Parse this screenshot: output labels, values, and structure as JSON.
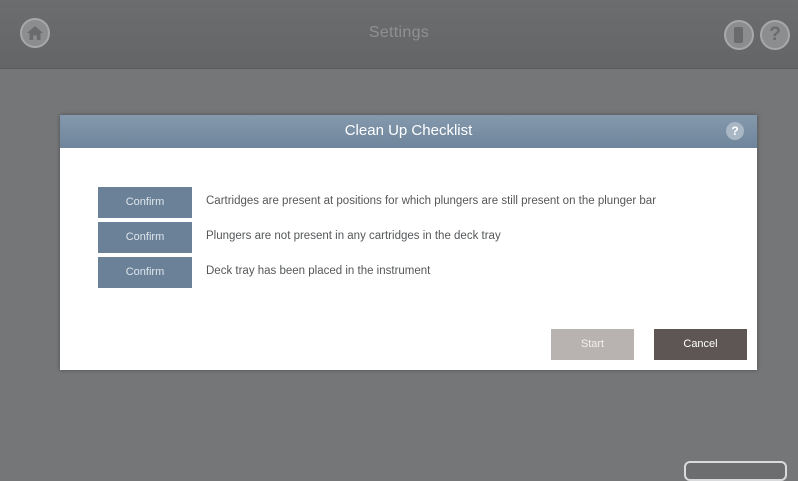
{
  "topbar": {
    "title": "Settings",
    "icons": [
      "home-icon",
      "device-icon",
      "help-icon"
    ],
    "help_glyph": "?"
  },
  "dialog": {
    "title": "Clean Up Checklist",
    "help_glyph": "?",
    "items": [
      {
        "button": "Confirm",
        "text": "Cartridges are present at positions for which plungers are still present on the plunger bar"
      },
      {
        "button": "Confirm",
        "text": "Plungers are not present in any cartridges in the deck tray"
      },
      {
        "button": "Confirm",
        "text": "Deck tray has been placed in the instrument"
      }
    ],
    "start_label": "Start",
    "cancel_label": "Cancel"
  },
  "colors": {
    "header": "#768ba0",
    "confirm": "#6a8197",
    "start_disabled": "#b8b2b0",
    "cancel": "#5e5654"
  }
}
